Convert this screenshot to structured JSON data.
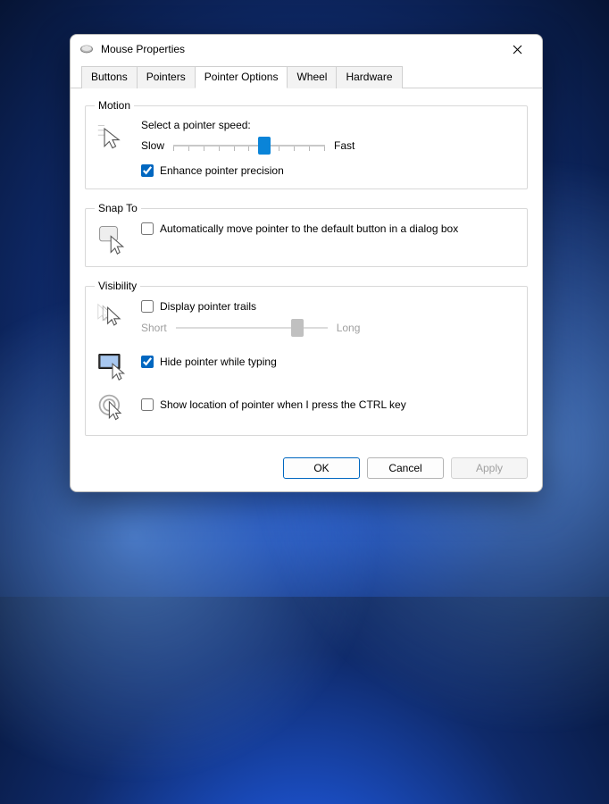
{
  "window": {
    "title": "Mouse Properties"
  },
  "tabs": {
    "buttons": "Buttons",
    "pointers": "Pointers",
    "pointer_options": "Pointer Options",
    "wheel": "Wheel",
    "hardware": "Hardware",
    "active": "pointer_options"
  },
  "motion": {
    "legend": "Motion",
    "speed_label": "Select a pointer speed:",
    "slow": "Slow",
    "fast": "Fast",
    "speed_value": 7,
    "speed_min": 1,
    "speed_max": 11,
    "enhance_precision_label": "Enhance pointer precision",
    "enhance_precision_checked": true
  },
  "snap_to": {
    "legend": "Snap To",
    "auto_move_label": "Automatically move pointer to the default button in a dialog box",
    "auto_move_checked": false
  },
  "visibility": {
    "legend": "Visibility",
    "trails_label": "Display pointer trails",
    "trails_checked": false,
    "trails_short": "Short",
    "trails_long": "Long",
    "trails_value": 9,
    "trails_min": 1,
    "trails_max": 11,
    "hide_label": "Hide pointer while typing",
    "hide_checked": true,
    "ctrl_label": "Show location of pointer when I press the CTRL key",
    "ctrl_checked": false
  },
  "buttons_row": {
    "ok": "OK",
    "cancel": "Cancel",
    "apply": "Apply"
  }
}
